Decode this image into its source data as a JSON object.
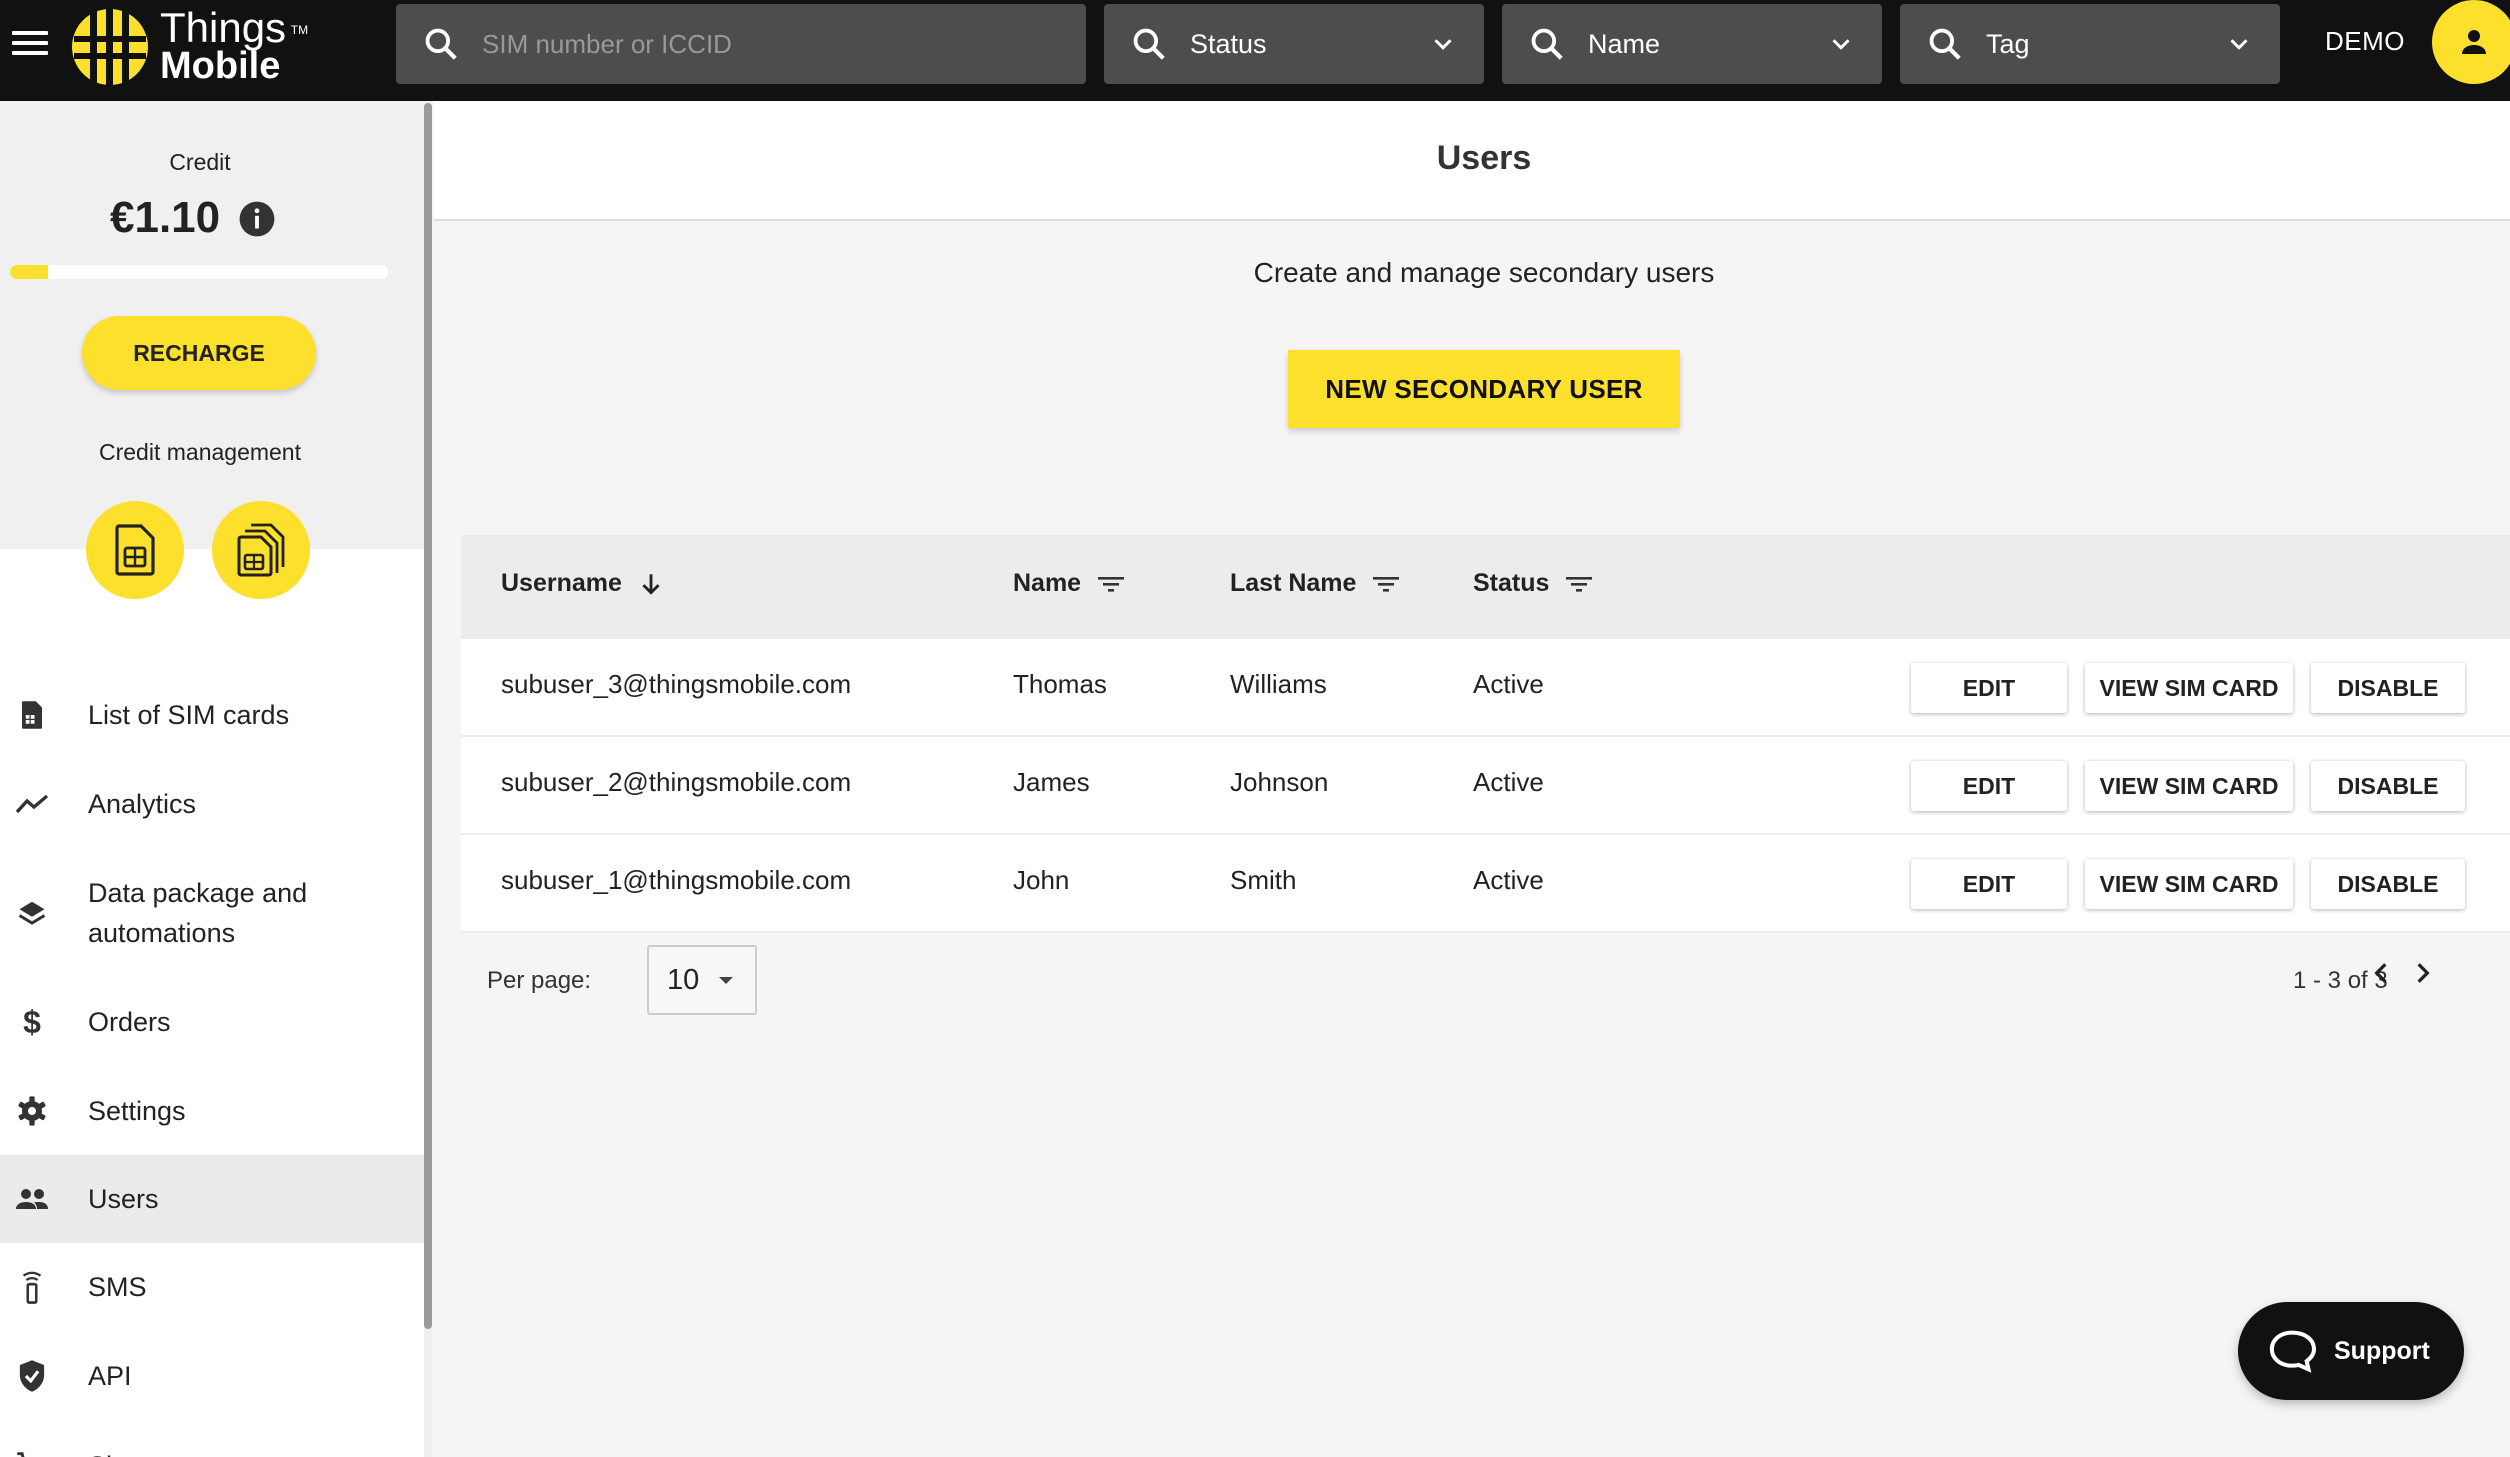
{
  "brand": {
    "line1": "Things",
    "tm": "TM",
    "line2": "Mobile",
    "accent_color": "#fde02b",
    "bar_color": "#111111"
  },
  "topbar": {
    "search_placeholder": "SIM number or ICCID",
    "filters": [
      {
        "label": "Status",
        "icon": "search-icon"
      },
      {
        "label": "Name",
        "icon": "search-icon"
      },
      {
        "label": "Tag",
        "icon": "search-icon"
      }
    ],
    "account_label": "DEMO"
  },
  "sidebar": {
    "credit_label": "Credit",
    "credit_value": "€1.10",
    "credit_progress_fraction": 0.1,
    "recharge_label": "RECHARGE",
    "credit_management_label": "Credit management",
    "nav": [
      {
        "label": "List of SIM cards",
        "icon": "sim-card-icon"
      },
      {
        "label": "Analytics",
        "icon": "analytics-icon"
      },
      {
        "label": "Data package and automations",
        "icon": "layers-icon"
      },
      {
        "label": "Orders",
        "icon": "dollar-icon"
      },
      {
        "label": "Settings",
        "icon": "gear-icon"
      },
      {
        "label": "Users",
        "icon": "users-icon",
        "active": true
      },
      {
        "label": "SMS",
        "icon": "sms-icon"
      },
      {
        "label": "API",
        "icon": "shield-icon"
      },
      {
        "label": "Shop",
        "icon": "cart-icon"
      }
    ]
  },
  "main": {
    "title": "Users",
    "subtitle": "Create and manage secondary users",
    "new_user_label": "NEW SECONDARY USER",
    "table": {
      "columns": [
        "Username",
        "Name",
        "Last Name",
        "Status"
      ],
      "rows": [
        {
          "username": "subuser_3@thingsmobile.com",
          "name": "Thomas",
          "last_name": "Williams",
          "status": "Active"
        },
        {
          "username": "subuser_2@thingsmobile.com",
          "name": "James",
          "last_name": "Johnson",
          "status": "Active"
        },
        {
          "username": "subuser_1@thingsmobile.com",
          "name": "John",
          "last_name": "Smith",
          "status": "Active"
        }
      ],
      "actions": {
        "edit": "EDIT",
        "view_sim": "VIEW SIM CARD",
        "disable": "DISABLE"
      }
    },
    "pagination": {
      "per_page_label": "Per page:",
      "per_page_value": "10",
      "range": "1 - 3 of 3"
    }
  },
  "support": {
    "label": "Support"
  }
}
